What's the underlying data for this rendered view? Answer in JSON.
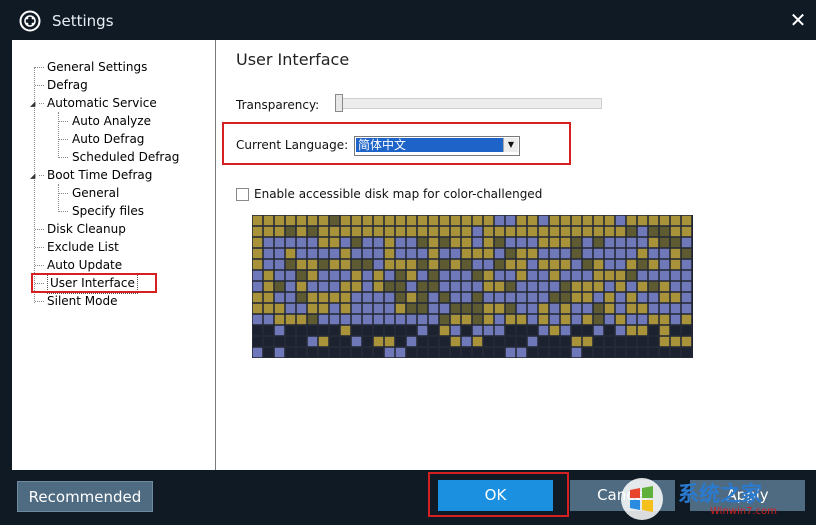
{
  "window": {
    "title": "Settings",
    "close_glyph": "✕"
  },
  "sidebar": {
    "items": [
      {
        "label": "General Settings"
      },
      {
        "label": "Defrag"
      },
      {
        "label": "Automatic Service",
        "expanded": true
      },
      {
        "label": "Auto Analyze"
      },
      {
        "label": "Auto Defrag"
      },
      {
        "label": "Scheduled Defrag"
      },
      {
        "label": "Boot Time Defrag",
        "expanded": true
      },
      {
        "label": "General"
      },
      {
        "label": "Specify files"
      },
      {
        "label": "Disk Cleanup"
      },
      {
        "label": "Exclude List"
      },
      {
        "label": "Auto Update"
      },
      {
        "label": "User Interface",
        "selected": true
      },
      {
        "label": "Silent Mode"
      }
    ]
  },
  "panel": {
    "title": "User Interface",
    "transparency_label": "Transparency:",
    "transparency_value": 0,
    "language_label": "Current Language:",
    "language_value": "简体中文",
    "accessible_label": "Enable accessible disk map for color-challenged",
    "accessible_checked": false
  },
  "buttons": {
    "recommended": "Recommended",
    "ok": "OK",
    "cancel": "Cancel",
    "apply": "Apply"
  },
  "watermark": {
    "logo_text": "系统之家",
    "url": "Winwin7.com"
  },
  "colors": {
    "dark_bg": "#0f1a24",
    "button": "#4e6b82",
    "ok_button": "#1b8fe0",
    "highlight": "#d42020",
    "disk_olive": "#a8923a",
    "disk_blue": "#6f78b8",
    "disk_dark": "#1d2230",
    "disk_dim": "#5e5a32"
  }
}
